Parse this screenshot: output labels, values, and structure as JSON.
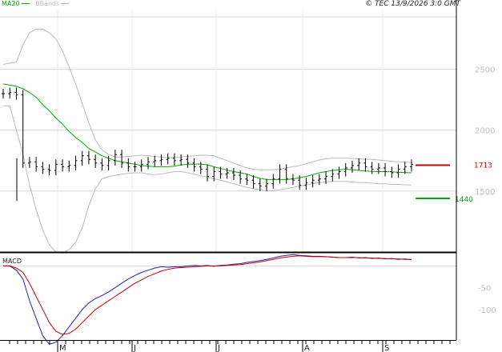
{
  "legend": {
    "ma_label": "MA20",
    "bb_label": "BBands",
    "ma_color": "#00aa00",
    "bb_color": "#bbbbbb"
  },
  "copyright": "© TEC 13/9/2026 3:0 GMT",
  "macd_label": "MACD",
  "levels": {
    "resistance": {
      "label": "1713",
      "value": 1713,
      "color": "#cc0000"
    },
    "support": {
      "label": "1440",
      "value": 1440,
      "color": "#00aa00"
    }
  },
  "chart_data": [
    {
      "type": "ohlc",
      "title": "",
      "yticks": [
        {
          "value": 2500,
          "label": "2500"
        },
        {
          "value": 2000,
          "label": "2000"
        },
        {
          "value": 1500,
          "label": "1500"
        }
      ],
      "ylim": [
        1000,
        2990
      ],
      "xticks": [
        "M",
        "J",
        "J",
        "A",
        "S"
      ],
      "grid": true,
      "series": [
        {
          "name": "MA20",
          "color": "#00aa00",
          "values": [
            2380,
            2370,
            2360,
            2340,
            2310,
            2270,
            2210,
            2160,
            2100,
            2050,
            1990,
            1940,
            1900,
            1850,
            1820,
            1790,
            1770,
            1750,
            1740,
            1730,
            1720,
            1710,
            1705,
            1700,
            1700,
            1700,
            1705,
            1715,
            1720,
            1722,
            1722,
            1715,
            1700,
            1685,
            1672,
            1660,
            1650,
            1640,
            1620,
            1605,
            1595,
            1595,
            1595,
            1595,
            1600,
            1610,
            1620,
            1635,
            1650,
            1660,
            1670,
            1675,
            1680,
            1675,
            1670,
            1665,
            1662,
            1660,
            1660,
            1658,
            1655,
            1652,
            1650
          ]
        },
        {
          "name": "BBands upper",
          "color": "#bbbbbb",
          "values": [
            2540,
            2550,
            2560,
            2700,
            2800,
            2830,
            2830,
            2800,
            2750,
            2650,
            2520,
            2380,
            2220,
            2060,
            1920,
            1840,
            1800,
            1780,
            1780,
            1785,
            1790,
            1795,
            1790,
            1785,
            1780,
            1775,
            1775,
            1780,
            1785,
            1790,
            1795,
            1795,
            1790,
            1770,
            1750,
            1730,
            1710,
            1690,
            1680,
            1675,
            1675,
            1675,
            1680,
            1690,
            1700,
            1710,
            1725,
            1740,
            1755,
            1765,
            1770,
            1770,
            1770,
            1768,
            1765,
            1762,
            1760,
            1755,
            1750,
            1745,
            1740,
            1738,
            1735
          ]
        },
        {
          "name": "BBands lower",
          "color": "#bbbbbb",
          "values": [
            2200,
            2200,
            2000,
            1800,
            1550,
            1350,
            1180,
            1060,
            1000,
            990,
            1020,
            1080,
            1200,
            1380,
            1520,
            1600,
            1620,
            1630,
            1640,
            1645,
            1650,
            1650,
            1640,
            1635,
            1640,
            1650,
            1660,
            1660,
            1650,
            1640,
            1625,
            1615,
            1600,
            1590,
            1575,
            1560,
            1545,
            1530,
            1520,
            1510,
            1500,
            1505,
            1510,
            1520,
            1530,
            1540,
            1550,
            1560,
            1570,
            1575,
            1580,
            1580,
            1580,
            1575,
            1570,
            1570,
            1565,
            1560,
            1560,
            1555,
            1555,
            1552,
            1550
          ]
        },
        {
          "name": "Price",
          "color": "#000000",
          "values": [
            2300,
            2310,
            2290,
            1730,
            1740,
            1700,
            1680,
            1670,
            1720,
            1700,
            1710,
            1750,
            1790,
            1760,
            1730,
            1710,
            1750,
            1800,
            1730,
            1700,
            1700,
            1720,
            1740,
            1750,
            1760,
            1770,
            1750,
            1760,
            1730,
            1700,
            1680,
            1620,
            1660,
            1640,
            1650,
            1630,
            1600,
            1590,
            1560,
            1540,
            1560,
            1600,
            1680,
            1600,
            1590,
            1550,
            1570,
            1590,
            1600,
            1620,
            1640,
            1660,
            1690,
            1710,
            1730,
            1700,
            1680,
            1690,
            1660,
            1650,
            1680,
            1700,
            1720
          ]
        }
      ]
    },
    {
      "type": "line",
      "title": "MACD",
      "yticks": [
        {
          "value": -50,
          "label": "-50"
        },
        {
          "value": -100,
          "label": "-100"
        }
      ],
      "ylim": [
        -170,
        30
      ],
      "series": [
        {
          "name": "",
          "color": "#2222aa",
          "values": [
            0,
            0,
            -10,
            -30,
            -80,
            -120,
            -160,
            -180,
            -175,
            -160,
            -140,
            -120,
            -100,
            -85,
            -75,
            -68,
            -60,
            -50,
            -40,
            -30,
            -22,
            -15,
            -10,
            -5,
            -2,
            -3,
            -2,
            -2,
            0,
            1,
            0,
            1,
            -1,
            1,
            2,
            4,
            5,
            8,
            10,
            12,
            15,
            18,
            22,
            24,
            26,
            24,
            23,
            22,
            22,
            21,
            20,
            19,
            19,
            20,
            18,
            19,
            17,
            18,
            16,
            17,
            15,
            16,
            14
          ]
        },
        {
          "name": "",
          "color": "#cc0000",
          "values": [
            0,
            0,
            -5,
            -15,
            -40,
            -70,
            -100,
            -130,
            -150,
            -157,
            -155,
            -145,
            -130,
            -115,
            -100,
            -90,
            -80,
            -70,
            -60,
            -50,
            -40,
            -32,
            -24,
            -18,
            -12,
            -8,
            -5,
            -4,
            -3,
            -2,
            -1,
            0,
            0,
            0,
            1,
            2,
            3,
            5,
            7,
            9,
            12,
            15,
            18,
            20,
            22,
            23,
            22,
            21,
            21,
            21,
            20,
            19,
            19,
            19,
            19,
            18,
            18,
            17,
            17,
            16,
            16,
            15,
            15
          ]
        }
      ]
    }
  ]
}
